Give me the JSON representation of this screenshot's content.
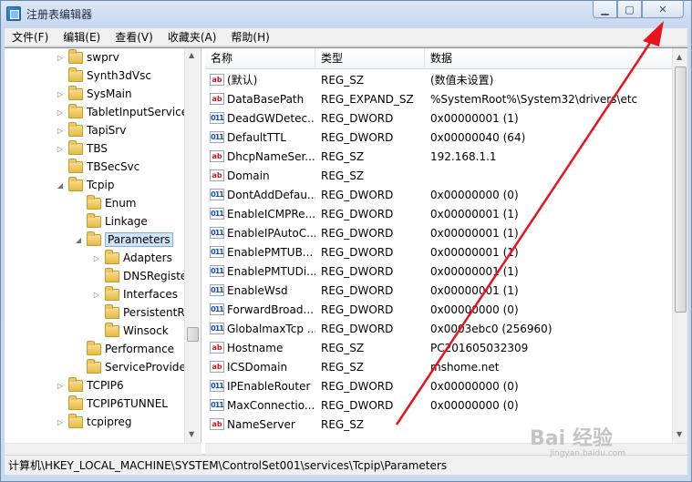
{
  "window": {
    "title": "注册表编辑器"
  },
  "caption_buttons": {
    "minimize": "▁",
    "maximize": "▢",
    "close": "✕"
  },
  "menu": [
    "文件(F)",
    "编辑(E)",
    "查看(V)",
    "收藏夹(A)",
    "帮助(H)"
  ],
  "tree": [
    {
      "label": "swprv",
      "toggle": "▷",
      "selected": false
    },
    {
      "label": "Synth3dVsc",
      "toggle": "",
      "selected": false
    },
    {
      "label": "SysMain",
      "toggle": "▷",
      "selected": false
    },
    {
      "label": "TabletInputService",
      "toggle": "▷",
      "selected": false
    },
    {
      "label": "TapiSrv",
      "toggle": "▷",
      "selected": false
    },
    {
      "label": "TBS",
      "toggle": "▷",
      "selected": false
    },
    {
      "label": "TBSecSvc",
      "toggle": "",
      "selected": false
    },
    {
      "label": "Tcpip",
      "toggle": "◢",
      "selected": false
    },
    {
      "label": "Enum",
      "toggle": "",
      "selected": false
    },
    {
      "label": "Linkage",
      "toggle": "",
      "selected": false
    },
    {
      "label": "Parameters",
      "toggle": "◢",
      "selected": true
    },
    {
      "label": "Adapters",
      "toggle": "▷",
      "selected": false
    },
    {
      "label": "DNSRegistere",
      "toggle": "",
      "selected": false
    },
    {
      "label": "Interfaces",
      "toggle": "▷",
      "selected": false
    },
    {
      "label": "PersistentRo",
      "toggle": "",
      "selected": false
    },
    {
      "label": "Winsock",
      "toggle": "",
      "selected": false
    },
    {
      "label": "Performance",
      "toggle": "",
      "selected": false
    },
    {
      "label": "ServiceProvide",
      "toggle": "",
      "selected": false
    },
    {
      "label": "TCPIP6",
      "toggle": "▷",
      "selected": false
    },
    {
      "label": "TCPIP6TUNNEL",
      "toggle": "",
      "selected": false
    },
    {
      "label": "tcpipreg",
      "toggle": "▷",
      "selected": false
    }
  ],
  "list_headers": {
    "name": "名称",
    "type": "类型",
    "data": "数据"
  },
  "values": [
    {
      "icon": "sz",
      "name": "(默认)",
      "type": "REG_SZ",
      "data": "(数值未设置)"
    },
    {
      "icon": "sz",
      "name": "DataBasePath",
      "type": "REG_EXPAND_SZ",
      "data": "%SystemRoot%\\System32\\drivers\\etc"
    },
    {
      "icon": "dword",
      "name": "DeadGWDetec...",
      "type": "REG_DWORD",
      "data": "0x00000001 (1)"
    },
    {
      "icon": "dword",
      "name": "DefaultTTL",
      "type": "REG_DWORD",
      "data": "0x00000040 (64)"
    },
    {
      "icon": "sz",
      "name": "DhcpNameSer...",
      "type": "REG_SZ",
      "data": "192.168.1.1"
    },
    {
      "icon": "sz",
      "name": "Domain",
      "type": "REG_SZ",
      "data": ""
    },
    {
      "icon": "dword",
      "name": "DontAddDefau...",
      "type": "REG_DWORD",
      "data": "0x00000000 (0)"
    },
    {
      "icon": "dword",
      "name": "EnableICMPRe...",
      "type": "REG_DWORD",
      "data": "0x00000001 (1)"
    },
    {
      "icon": "dword",
      "name": "EnableIPAutoC...",
      "type": "REG_DWORD",
      "data": "0x00000001 (1)"
    },
    {
      "icon": "dword",
      "name": "EnablePMTUB...",
      "type": "REG_DWORD",
      "data": "0x00000001 (1)"
    },
    {
      "icon": "dword",
      "name": "EnablePMTUDi...",
      "type": "REG_DWORD",
      "data": "0x00000001 (1)"
    },
    {
      "icon": "dword",
      "name": "EnableWsd",
      "type": "REG_DWORD",
      "data": "0x00000001 (1)"
    },
    {
      "icon": "dword",
      "name": "ForwardBroad...",
      "type": "REG_DWORD",
      "data": "0x00000000 (0)"
    },
    {
      "icon": "dword",
      "name": "GlobalmaxTcp ...",
      "type": "REG_DWORD",
      "data": "0x0003ebc0 (256960)"
    },
    {
      "icon": "sz",
      "name": "Hostname",
      "type": "REG_SZ",
      "data": "PC201605032309"
    },
    {
      "icon": "sz",
      "name": "ICSDomain",
      "type": "REG_SZ",
      "data": "mshome.net"
    },
    {
      "icon": "dword",
      "name": "IPEnableRouter",
      "type": "REG_DWORD",
      "data": "0x00000000 (0)"
    },
    {
      "icon": "dword",
      "name": "MaxConnectio...",
      "type": "REG_DWORD",
      "data": "0x00000000 (0)"
    },
    {
      "icon": "sz",
      "name": "NameServer",
      "type": "REG_SZ",
      "data": ""
    }
  ],
  "icon_glyphs": {
    "sz": "ab",
    "dword": "011"
  },
  "statusbar": {
    "path": "计算机\\HKEY_LOCAL_MACHINE\\SYSTEM\\ControlSet001\\services\\Tcpip\\Parameters"
  },
  "watermark": {
    "logo": "Bai 经验",
    "url": "jingyan.baidu.com"
  },
  "annotation": {
    "color": "#e8141b"
  }
}
